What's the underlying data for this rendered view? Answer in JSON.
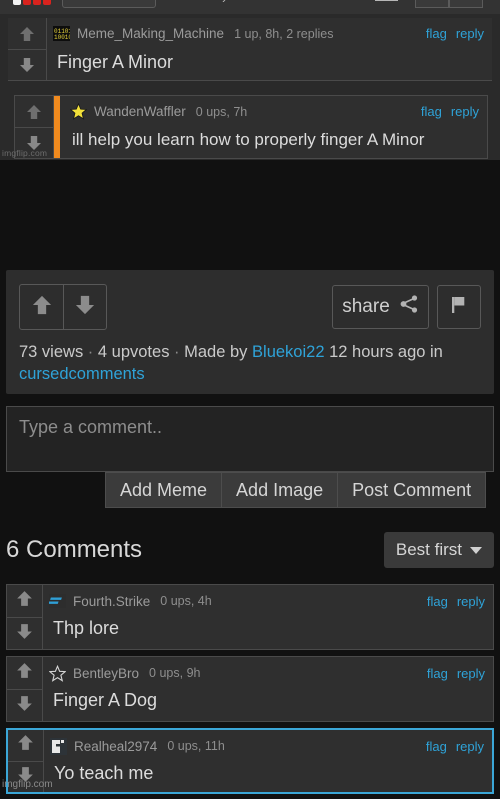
{
  "site": {
    "name": "imgflip.com",
    "watermark": "imgflip.com"
  },
  "topbar": {
    "logo": "imgflip-logo",
    "search_placeholder": "",
    "caret": "›"
  },
  "meme_image": {
    "comments": [
      {
        "avatar": "binary-code-avatar",
        "username": "Meme_Making_Machine",
        "meta": "1 up, 8h, 2 replies",
        "text": "Finger A Minor",
        "flag": "flag",
        "reply": "reply",
        "nested": false
      },
      {
        "avatar": "star-avatar",
        "username": "WandenWaffler",
        "meta": "0 ups, 7h",
        "text": "ill help you learn how to properly finger A Minor",
        "flag": "flag",
        "reply": "reply",
        "nested": true
      }
    ]
  },
  "meta_panel": {
    "upvote_icon": "up-arrow-icon",
    "downvote_icon": "down-arrow-icon",
    "share_label": "share",
    "share_icon": "share-icon",
    "flag_icon": "flag-icon",
    "views": "73 views",
    "upvotes": "4 upvotes",
    "made_by_prefix": "Made by",
    "author": "Bluekoi22",
    "time_ago": "12 hours ago in",
    "stream": "cursedcomments",
    "separator": "·"
  },
  "comment_form": {
    "placeholder": "Type a comment..",
    "value": "",
    "add_meme_label": "Add Meme",
    "add_image_label": "Add Image",
    "post_label": "Post Comment"
  },
  "comments_header": {
    "title": "6 Comments",
    "sort_label": "Best first"
  },
  "comments": [
    {
      "avatar": "blue-dash-avatar",
      "username": "Fourth.Strike",
      "meta": "0 ups, 4h",
      "text": "Thp lore",
      "flag": "flag",
      "reply": "reply",
      "selected": false
    },
    {
      "avatar": "outline-star-avatar",
      "username": "BentleyBro",
      "meta": "0 ups, 9h",
      "text": "Finger A Dog",
      "flag": "flag",
      "reply": "reply",
      "selected": false
    },
    {
      "avatar": "white-block-avatar",
      "username": "Realheal2974",
      "meta": "0 ups, 11h",
      "text": "Yo teach me",
      "flag": "flag",
      "reply": "reply",
      "selected": true
    }
  ],
  "colors": {
    "accent_link": "#2fa3d8",
    "selection_border": "#3ba6d6",
    "nested_bar": "#f08a1e",
    "page_bg": "#111111",
    "panel_bg": "#2d2d2d",
    "comment_bg": "#2f2f2f"
  }
}
